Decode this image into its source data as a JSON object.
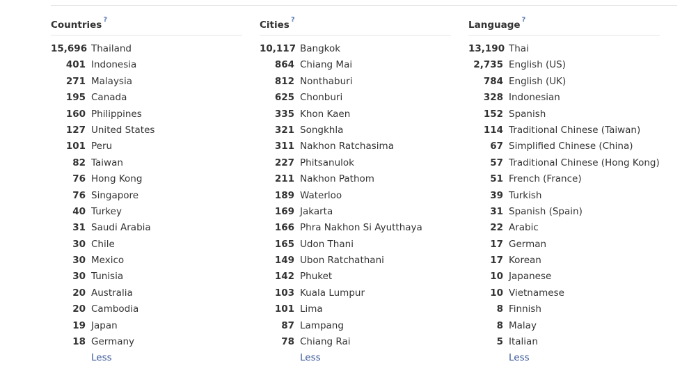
{
  "countries": {
    "title": "Countries",
    "help": "?",
    "less": "Less",
    "rows": [
      {
        "count": "15,696",
        "label": "Thailand"
      },
      {
        "count": "401",
        "label": "Indonesia"
      },
      {
        "count": "271",
        "label": "Malaysia"
      },
      {
        "count": "195",
        "label": "Canada"
      },
      {
        "count": "160",
        "label": "Philippines"
      },
      {
        "count": "127",
        "label": "United States"
      },
      {
        "count": "101",
        "label": "Peru"
      },
      {
        "count": "82",
        "label": "Taiwan"
      },
      {
        "count": "76",
        "label": "Hong Kong"
      },
      {
        "count": "76",
        "label": "Singapore"
      },
      {
        "count": "40",
        "label": "Turkey"
      },
      {
        "count": "31",
        "label": "Saudi Arabia"
      },
      {
        "count": "30",
        "label": "Chile"
      },
      {
        "count": "30",
        "label": "Mexico"
      },
      {
        "count": "30",
        "label": "Tunisia"
      },
      {
        "count": "20",
        "label": "Australia"
      },
      {
        "count": "20",
        "label": "Cambodia"
      },
      {
        "count": "19",
        "label": "Japan"
      },
      {
        "count": "18",
        "label": "Germany"
      }
    ]
  },
  "cities": {
    "title": "Cities",
    "help": "?",
    "less": "Less",
    "rows": [
      {
        "count": "10,117",
        "label": "Bangkok"
      },
      {
        "count": "864",
        "label": "Chiang Mai"
      },
      {
        "count": "812",
        "label": "Nonthaburi"
      },
      {
        "count": "625",
        "label": "Chonburi"
      },
      {
        "count": "335",
        "label": "Khon Kaen"
      },
      {
        "count": "321",
        "label": "Songkhla"
      },
      {
        "count": "311",
        "label": "Nakhon Ratchasima"
      },
      {
        "count": "227",
        "label": "Phitsanulok"
      },
      {
        "count": "211",
        "label": "Nakhon Pathom"
      },
      {
        "count": "189",
        "label": "Waterloo"
      },
      {
        "count": "169",
        "label": "Jakarta"
      },
      {
        "count": "166",
        "label": "Phra Nakhon Si Ayutthaya"
      },
      {
        "count": "165",
        "label": "Udon Thani"
      },
      {
        "count": "149",
        "label": "Ubon Ratchathani"
      },
      {
        "count": "142",
        "label": "Phuket"
      },
      {
        "count": "103",
        "label": "Kuala Lumpur"
      },
      {
        "count": "101",
        "label": "Lima"
      },
      {
        "count": "87",
        "label": "Lampang"
      },
      {
        "count": "78",
        "label": "Chiang Rai"
      }
    ]
  },
  "language": {
    "title": "Language",
    "help": "?",
    "less": "Less",
    "rows": [
      {
        "count": "13,190",
        "label": "Thai"
      },
      {
        "count": "2,735",
        "label": "English (US)"
      },
      {
        "count": "784",
        "label": "English (UK)"
      },
      {
        "count": "328",
        "label": "Indonesian"
      },
      {
        "count": "152",
        "label": "Spanish"
      },
      {
        "count": "114",
        "label": "Traditional Chinese (Taiwan)"
      },
      {
        "count": "67",
        "label": "Simplified Chinese (China)"
      },
      {
        "count": "57",
        "label": "Traditional Chinese (Hong Kong)"
      },
      {
        "count": "51",
        "label": "French (France)"
      },
      {
        "count": "39",
        "label": "Turkish"
      },
      {
        "count": "31",
        "label": "Spanish (Spain)"
      },
      {
        "count": "22",
        "label": "Arabic"
      },
      {
        "count": "17",
        "label": "German"
      },
      {
        "count": "17",
        "label": "Korean"
      },
      {
        "count": "10",
        "label": "Japanese"
      },
      {
        "count": "10",
        "label": "Vietnamese"
      },
      {
        "count": "8",
        "label": "Finnish"
      },
      {
        "count": "8",
        "label": "Malay"
      },
      {
        "count": "5",
        "label": "Italian"
      }
    ]
  }
}
